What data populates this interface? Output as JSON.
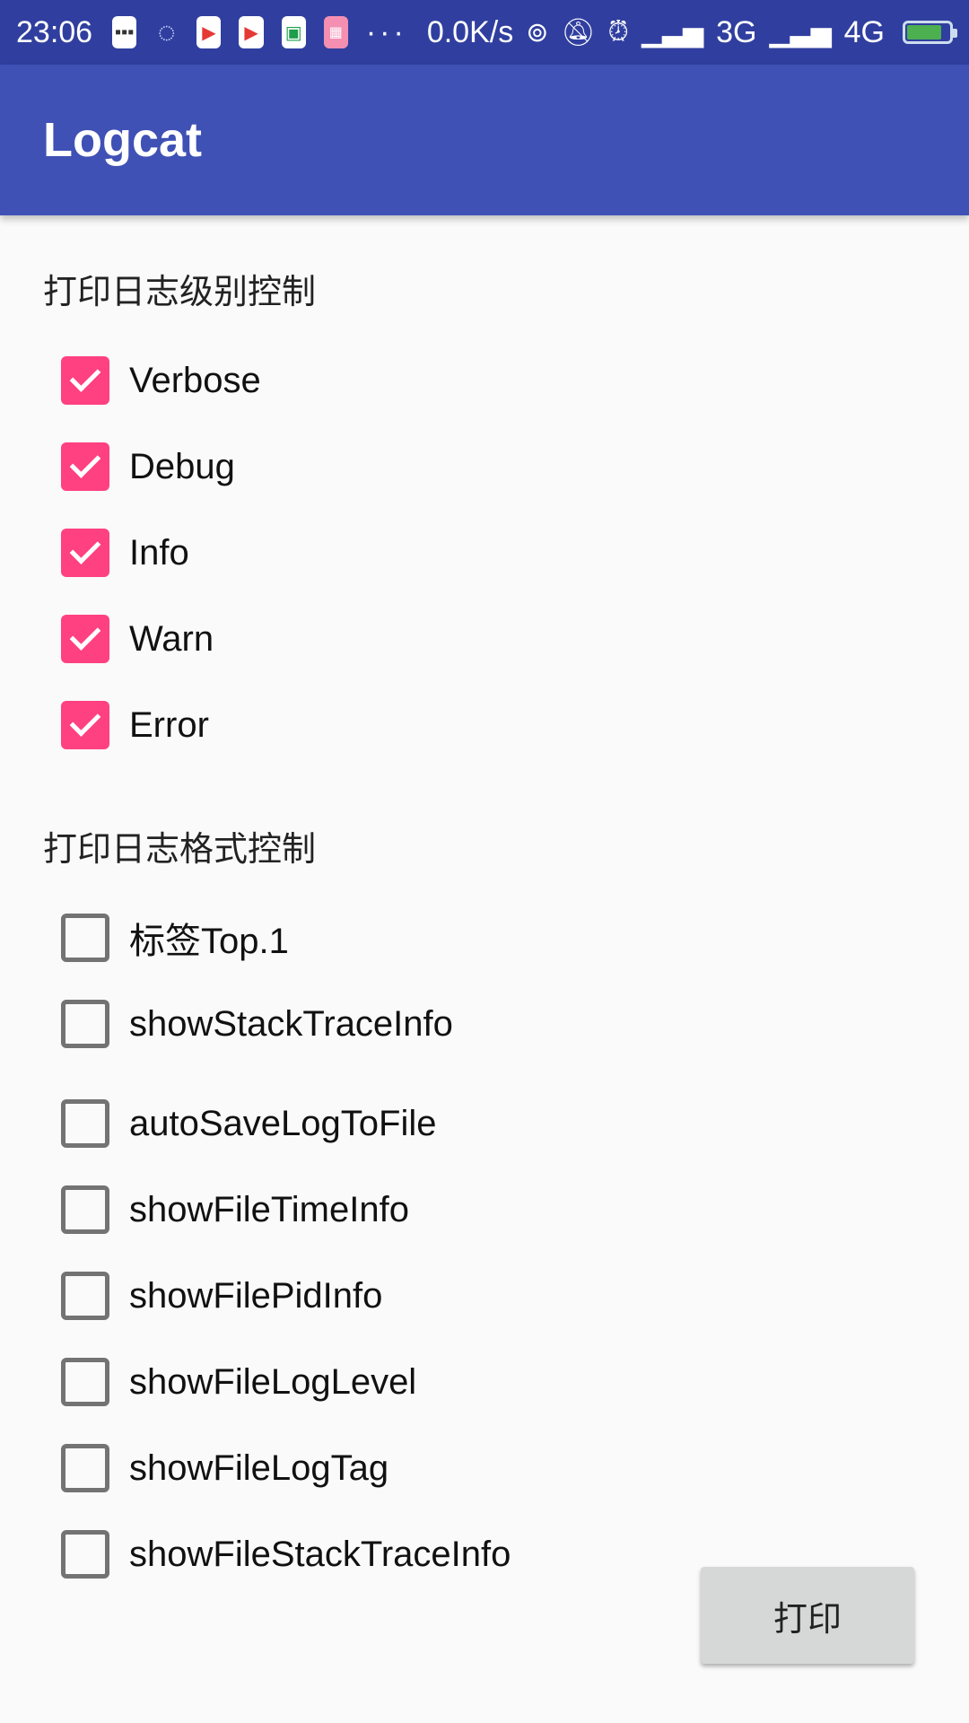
{
  "status_bar": {
    "time": "23:06",
    "network_speed": "0.0K/s",
    "network_3g": "3G",
    "network_4g": "4G",
    "dots": "···",
    "icons": [
      "message-icon",
      "loader-icon",
      "play-store-icon",
      "play-store-icon",
      "mi-icon",
      "bilibili-icon",
      "hotspot-icon",
      "bell-off-icon",
      "alarm-icon",
      "signal-icon",
      "signal-hd-icon",
      "battery-charging-icon"
    ]
  },
  "app_bar": {
    "title": "Logcat"
  },
  "level_section": {
    "title": "打印日志级别控制",
    "items": [
      {
        "label": "Verbose",
        "checked": true
      },
      {
        "label": "Debug",
        "checked": true
      },
      {
        "label": "Info",
        "checked": true
      },
      {
        "label": "Warn",
        "checked": true
      },
      {
        "label": "Error",
        "checked": true
      }
    ]
  },
  "format_section": {
    "title": "打印日志格式控制",
    "items": [
      {
        "label": "标签Top.1",
        "checked": false
      },
      {
        "label": "showStackTraceInfo",
        "checked": false
      },
      {
        "label": "autoSaveLogToFile",
        "checked": false
      },
      {
        "label": "showFileTimeInfo",
        "checked": false
      },
      {
        "label": "showFilePidInfo",
        "checked": false
      },
      {
        "label": "showFileLogLevel",
        "checked": false
      },
      {
        "label": "showFileLogTag",
        "checked": false
      },
      {
        "label": "showFileStackTraceInfo",
        "checked": false
      }
    ]
  },
  "print_button": {
    "label": "打印"
  },
  "colors": {
    "status_bar": "#303f9f",
    "app_bar": "#3f51b5",
    "checkbox_accent": "#ff4081",
    "background": "#fafafa"
  }
}
